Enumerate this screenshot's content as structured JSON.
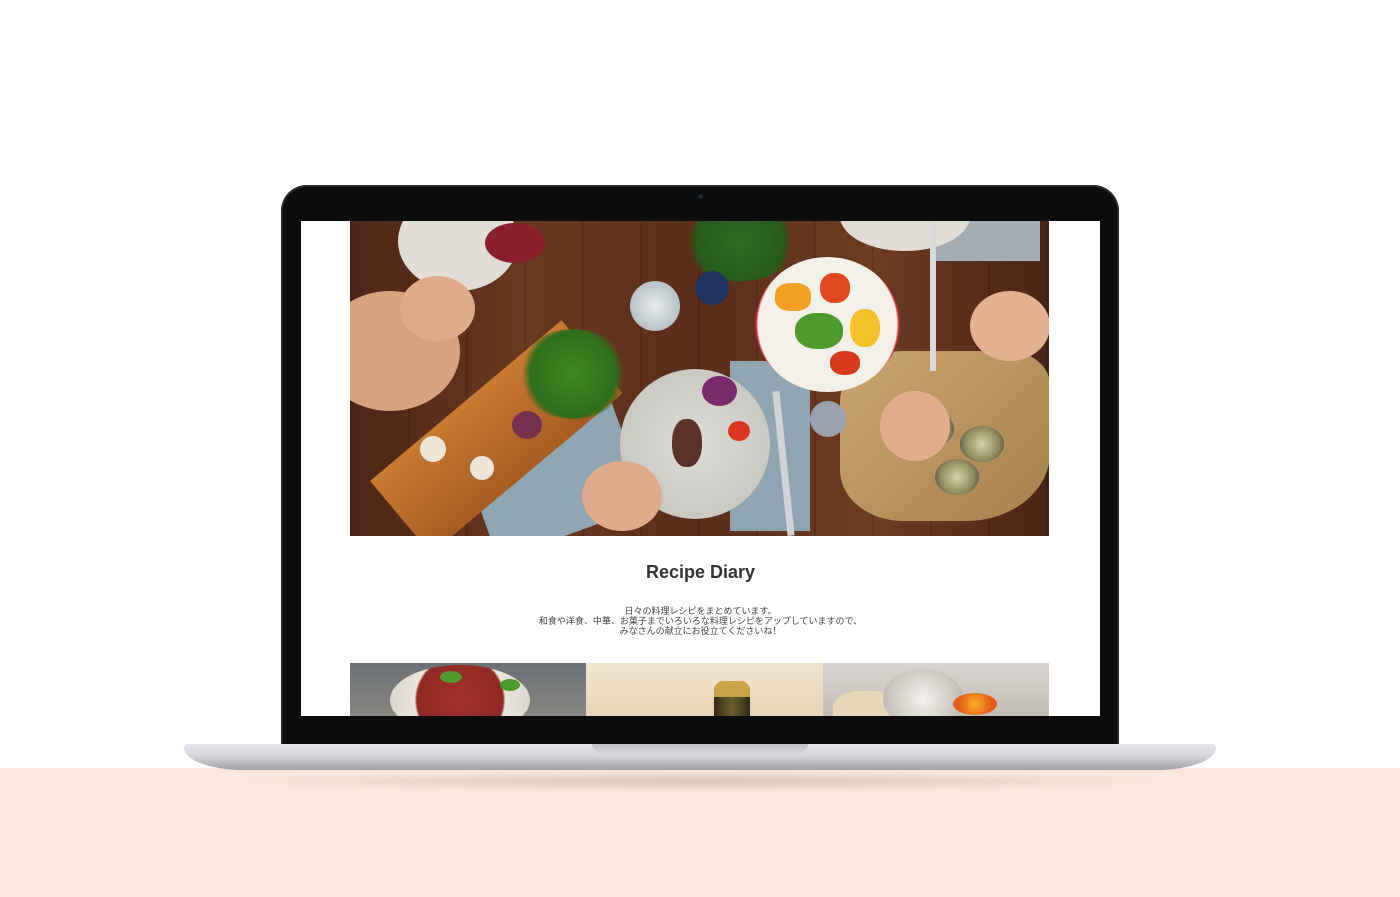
{
  "page": {
    "title": "Recipe Diary",
    "intro_lines": [
      "日々の料理レシピをまとめています。",
      "和食や洋食、中華、お菓子までいろいろな料理レシピをアップしていますので、",
      "みなさんの献立にお役立てくださいね！"
    ]
  },
  "images": {
    "hero": "hero-food-table-image",
    "thumbnails": [
      "thumbnail-tomato-pasta",
      "thumbnail-champagne",
      "thumbnail-salad"
    ]
  },
  "colors": {
    "surface": "#fbe8dc",
    "lid": "#0c0c0c",
    "title_text": "#333333"
  }
}
